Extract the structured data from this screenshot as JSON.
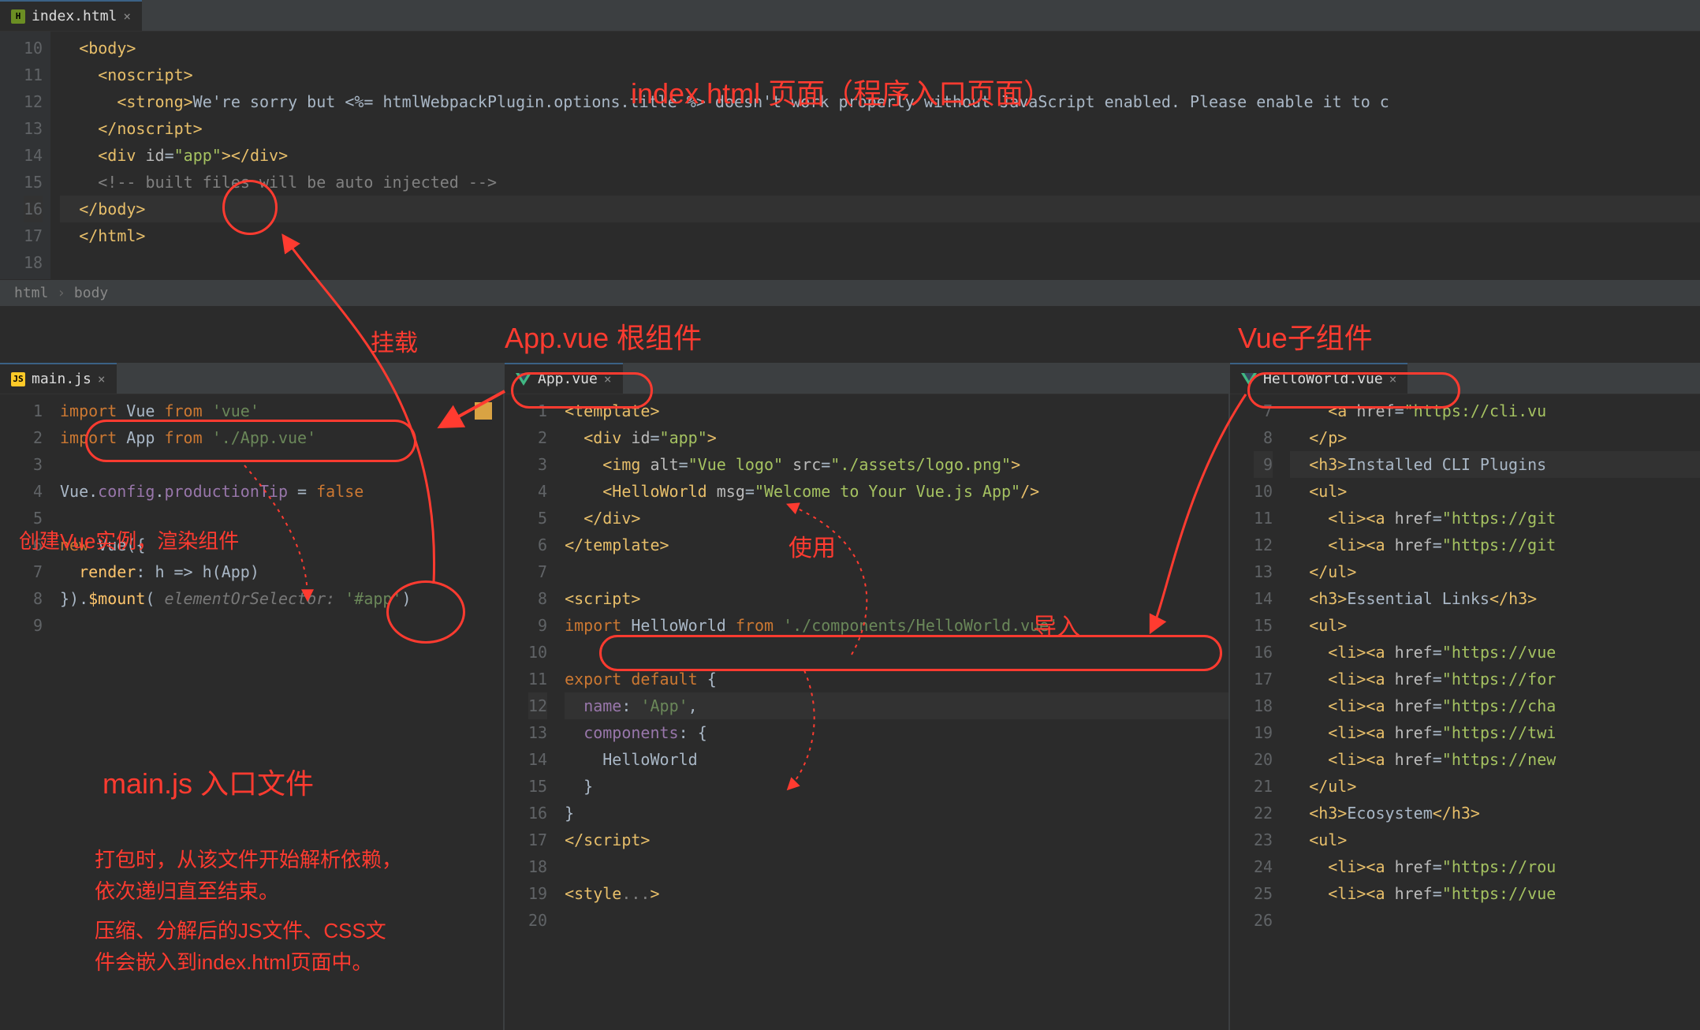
{
  "tabs": {
    "index": "index.html",
    "main": "main.js",
    "app": "App.vue",
    "hello": "HelloWorld.vue"
  },
  "breadcrumb": {
    "a": "html",
    "b": "body"
  },
  "annotations": {
    "index_title": "index.html 页面（程序入口页面）",
    "mount": "挂载",
    "app_title": "App.vue 根组件",
    "sub_title": "Vue子组件",
    "use": "使用",
    "import": "导入",
    "main_title": "main.js 入口文件",
    "create_vue": "创建Vue实例，渲染组件",
    "note1": "打包时，从该文件开始解析依赖，",
    "note2": "依次递归直至结束。",
    "note3": "压缩、分解后的JS文件、CSS文",
    "note4": "件会嵌入到index.html页面中。"
  },
  "index_lines": [
    {
      "n": "10",
      "html": "<span class='tag'>&lt;body&gt;</span>"
    },
    {
      "n": "11",
      "html": "  <span class='tag'>&lt;noscript&gt;</span>"
    },
    {
      "n": "12",
      "html": "    <span class='tag'>&lt;strong&gt;</span><span class='wh'>We're sorry but &lt;%= htmlWebpackPlugin.options.title %&gt; doesn't work properly without JavaScript enabled. Please enable it to c</span>"
    },
    {
      "n": "13",
      "html": "  <span class='tag'>&lt;/noscript&gt;</span>"
    },
    {
      "n": "14",
      "html": "  <span class='tag'>&lt;div </span><span class='attr'>id</span><span class='wh'>=</span><span class='strg'>\"app\"</span><span class='tag'>&gt;&lt;/div&gt;</span>"
    },
    {
      "n": "15",
      "html": "  <span class='cm'>&lt;!-- built files will be auto injected --&gt;</span>"
    },
    {
      "n": "16",
      "html": "<span class='tag'>&lt;/body&gt;</span>"
    },
    {
      "n": "17",
      "html": "<span class='tag'>&lt;/html&gt;</span>"
    },
    {
      "n": "18",
      "html": ""
    }
  ],
  "main_lines": [
    {
      "n": "1",
      "html": "<span class='kw'>import</span> <span class='wh'>Vue</span> <span class='kw'>from</span> <span class='str'>'vue'</span>"
    },
    {
      "n": "2",
      "html": "<span class='kw'>import</span> <span class='wh'>App</span> <span class='kw'>from</span> <span class='str'>'./App.vue'</span>"
    },
    {
      "n": "3",
      "html": ""
    },
    {
      "n": "4",
      "html": "<span class='wh'>Vue</span>.<span class='id'>config</span>.<span class='id'>productionTip</span> = <span class='kw'>false</span>"
    },
    {
      "n": "5",
      "html": ""
    },
    {
      "n": "6",
      "html": "<span class='kw'>new</span> <span class='wh'>Vue</span>({"
    },
    {
      "n": "7",
      "html": "  <span class='fn'>render</span>: <span class='wh'>h =&gt; h(App)</span>"
    },
    {
      "n": "8",
      "html": "}).<span class='fn'>$mount</span>( <span class='pl'>elementOrSelector:</span> <span class='str'>'#app'</span>)"
    },
    {
      "n": "9",
      "html": ""
    }
  ],
  "app_lines": [
    {
      "n": "1",
      "html": "<span class='tag'>&lt;template&gt;</span>"
    },
    {
      "n": "2",
      "html": "  <span class='tag'>&lt;div </span><span class='attr'>id</span>=<span class='strg'>\"app\"</span><span class='tag'>&gt;</span>"
    },
    {
      "n": "3",
      "html": "    <span class='tag'>&lt;img </span><span class='attr'>alt</span>=<span class='strg'>\"Vue logo\"</span> <span class='attr'>src</span>=<span class='strg'>\"./assets/logo.png\"</span><span class='tag'>&gt;</span>"
    },
    {
      "n": "4",
      "html": "    <span class='tag'>&lt;HelloWorld </span><span class='attr'>msg</span>=<span class='strg'>\"Welcome to Your Vue.js App\"</span><span class='tag'>/&gt;</span>"
    },
    {
      "n": "5",
      "html": "  <span class='tag'>&lt;/div&gt;</span>"
    },
    {
      "n": "6",
      "html": "<span class='tag'>&lt;/template&gt;</span>"
    },
    {
      "n": "7",
      "html": ""
    },
    {
      "n": "8",
      "html": "<span class='tag'>&lt;script&gt;</span>"
    },
    {
      "n": "9",
      "html": "<span class='kw'>import</span> <span class='wh'>HelloWorld</span> <span class='kw'>from</span> <span class='str'>'./components/HelloWorld.vue'</span>"
    },
    {
      "n": "10",
      "html": ""
    },
    {
      "n": "11",
      "html": "<span class='kw'>export default</span> {"
    },
    {
      "n": "12",
      "html": "  <span class='id'>name</span>: <span class='str'>'App'</span>,"
    },
    {
      "n": "13",
      "html": "  <span class='id'>components</span>: {"
    },
    {
      "n": "14",
      "html": "    <span class='wh'>HelloWorld</span>"
    },
    {
      "n": "15",
      "html": "  }"
    },
    {
      "n": "16",
      "html": "}"
    },
    {
      "n": "17",
      "html": "<span class='tag'>&lt;/script&gt;</span>"
    },
    {
      "n": "18",
      "html": ""
    },
    {
      "n": "19",
      "html": "<span class='tag'>&lt;style</span><span class='cm'>...</span><span class='tag'>&gt;</span>"
    },
    {
      "n": "20",
      "html": ""
    }
  ],
  "hello_lines": [
    {
      "n": "7",
      "html": "    <span class='tag'>&lt;a </span><span class='attr'>href</span>=<span class='strg'>\"https://cli.vu</span>"
    },
    {
      "n": "8",
      "html": "  <span class='tag'>&lt;/p&gt;</span>"
    },
    {
      "n": "9",
      "html": "  <span class='tag'>&lt;h3&gt;</span><span class='wh'>Installed CLI Plugins</span>"
    },
    {
      "n": "10",
      "html": "  <span class='tag'>&lt;ul&gt;</span>"
    },
    {
      "n": "11",
      "html": "    <span class='tag'>&lt;li&gt;&lt;a </span><span class='attr'>href</span>=<span class='strg'>\"https://git</span>"
    },
    {
      "n": "12",
      "html": "    <span class='tag'>&lt;li&gt;&lt;a </span><span class='attr'>href</span>=<span class='strg'>\"https://git</span>"
    },
    {
      "n": "13",
      "html": "  <span class='tag'>&lt;/ul&gt;</span>"
    },
    {
      "n": "14",
      "html": "  <span class='tag'>&lt;h3&gt;</span><span class='wh'>Essential Links</span><span class='tag'>&lt;/h3&gt;</span>"
    },
    {
      "n": "15",
      "html": "  <span class='tag'>&lt;ul&gt;</span>"
    },
    {
      "n": "16",
      "html": "    <span class='tag'>&lt;li&gt;&lt;a </span><span class='attr'>href</span>=<span class='strg'>\"https://vue</span>"
    },
    {
      "n": "17",
      "html": "    <span class='tag'>&lt;li&gt;&lt;a </span><span class='attr'>href</span>=<span class='strg'>\"https://for</span>"
    },
    {
      "n": "18",
      "html": "    <span class='tag'>&lt;li&gt;&lt;a </span><span class='attr'>href</span>=<span class='strg'>\"https://cha</span>"
    },
    {
      "n": "19",
      "html": "    <span class='tag'>&lt;li&gt;&lt;a </span><span class='attr'>href</span>=<span class='strg'>\"https://twi</span>"
    },
    {
      "n": "20",
      "html": "    <span class='tag'>&lt;li&gt;&lt;a </span><span class='attr'>href</span>=<span class='strg'>\"https://new</span>"
    },
    {
      "n": "21",
      "html": "  <span class='tag'>&lt;/ul&gt;</span>"
    },
    {
      "n": "22",
      "html": "  <span class='tag'>&lt;h3&gt;</span><span class='wh'>Ecosystem</span><span class='tag'>&lt;/h3&gt;</span>"
    },
    {
      "n": "23",
      "html": "  <span class='tag'>&lt;ul&gt;</span>"
    },
    {
      "n": "24",
      "html": "    <span class='tag'>&lt;li&gt;&lt;a </span><span class='attr'>href</span>=<span class='strg'>\"https://rou</span>"
    },
    {
      "n": "25",
      "html": "    <span class='tag'>&lt;li&gt;&lt;a </span><span class='attr'>href</span>=<span class='strg'>\"https://vue</span>"
    },
    {
      "n": "26",
      "html": ""
    }
  ]
}
